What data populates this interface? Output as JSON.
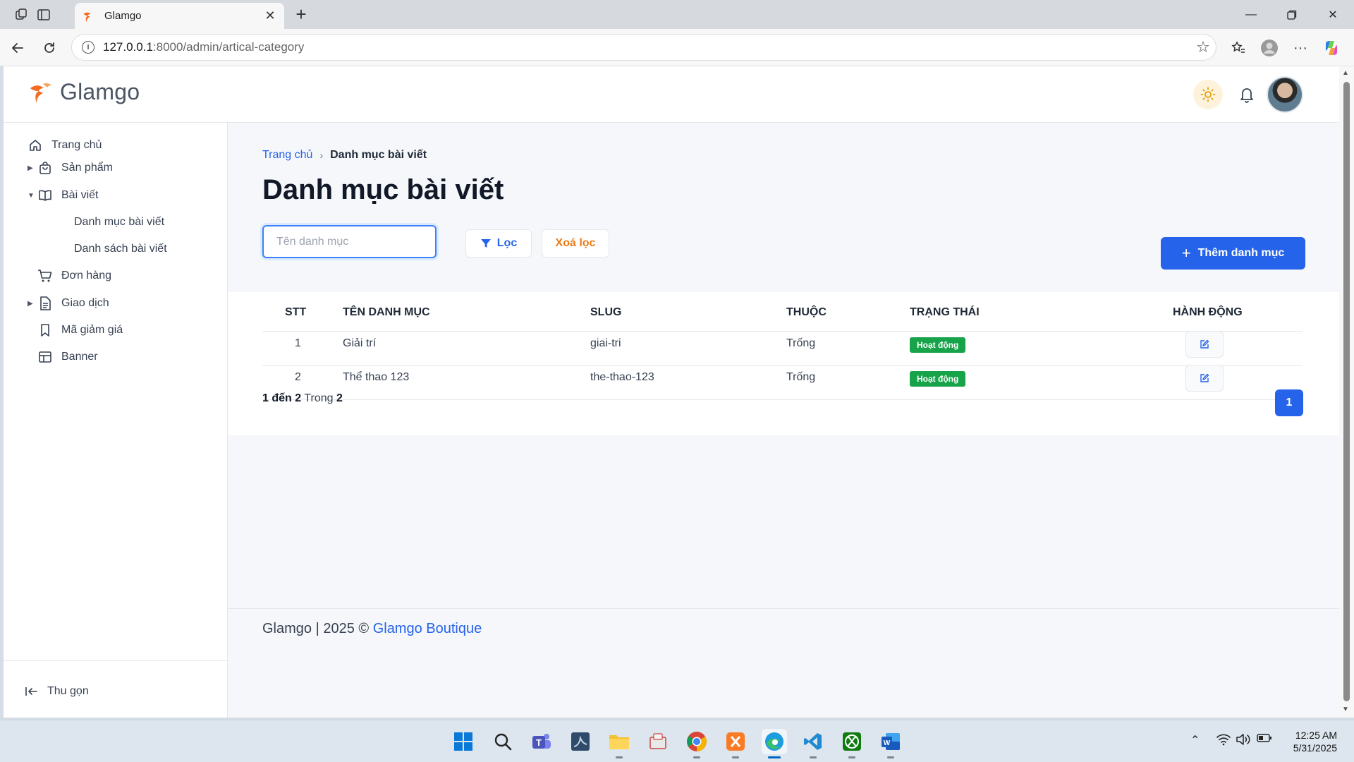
{
  "browser": {
    "tab_title": "Glamgo",
    "url_host": "127.0.0.1",
    "url_rest": ":8000/admin/artical-category"
  },
  "app": {
    "brand": "Glamgo"
  },
  "sidebar": {
    "items": [
      {
        "label": "Trang chủ",
        "icon": "home-icon",
        "caret": ""
      },
      {
        "label": "Sản phẩm",
        "icon": "shopping-bag-icon",
        "caret": "▶"
      },
      {
        "label": "Bài viết",
        "icon": "book-open-icon",
        "caret": "▼"
      },
      {
        "label": "Danh mục bài viết",
        "icon": "",
        "caret": ""
      },
      {
        "label": "Danh sách bài viết",
        "icon": "",
        "caret": ""
      },
      {
        "label": "Đơn hàng",
        "icon": "cart-icon",
        "caret": ""
      },
      {
        "label": "Giao dịch",
        "icon": "document-icon",
        "caret": "▶"
      },
      {
        "label": "Mã giảm giá",
        "icon": "bookmark-icon",
        "caret": ""
      },
      {
        "label": "Banner",
        "icon": "layout-icon",
        "caret": ""
      }
    ],
    "collapse_label": "Thu gọn"
  },
  "breadcrumb": {
    "home": "Trang chủ",
    "current": "Danh mục bài viết"
  },
  "page_title": "Danh mục bài viết",
  "filters": {
    "name_placeholder": "Tên danh mục",
    "name_value": "",
    "filter_label": "Lọc",
    "clear_label": "Xoá lọc",
    "add_label": "Thêm danh mục"
  },
  "table": {
    "columns": [
      "STT",
      "TÊN DANH MỤC",
      "SLUG",
      "THUỘC",
      "TRẠNG THÁI",
      "HÀNH ĐỘNG"
    ],
    "rows": [
      {
        "stt": "1",
        "name": "Giải trí",
        "slug": "giai-tri",
        "parent": "Trống",
        "status": "Hoạt động"
      },
      {
        "stt": "2",
        "name": "Thể thao 123",
        "slug": "the-thao-123",
        "parent": "Trống",
        "status": "Hoạt động"
      }
    ],
    "status_color": "#16a34a"
  },
  "pagination": {
    "from": "1",
    "to_word": "đến",
    "to": "2",
    "of_word": "Trong",
    "total": "2",
    "current_page": "1"
  },
  "footer": {
    "text": "Glamgo | 2025 ©",
    "link": "Glamgo Boutique"
  },
  "taskbar": {
    "time": "12:25 AM",
    "date": "5/31/2025"
  },
  "colors": {
    "accent": "#2563eb",
    "orange": "#ea7a18"
  }
}
